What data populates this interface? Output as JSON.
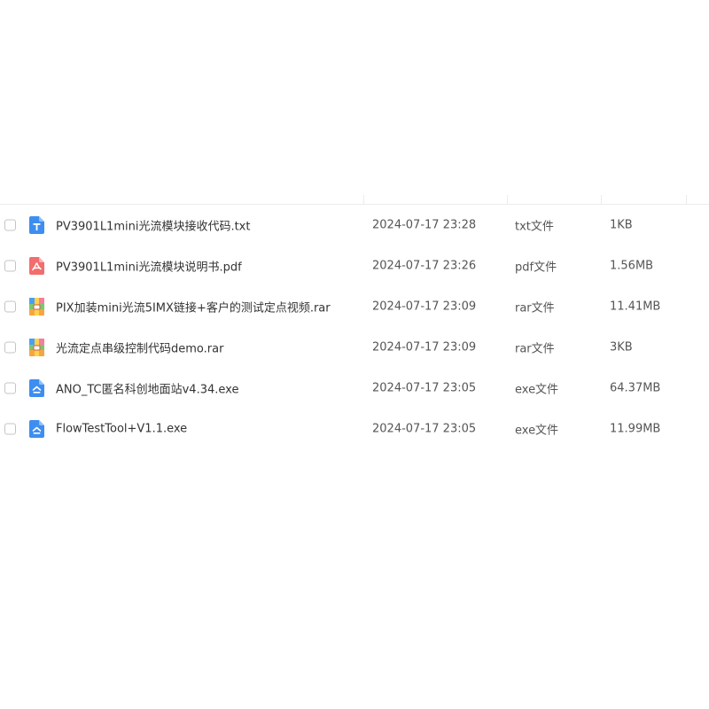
{
  "file_list": {
    "rows": [
      {
        "name": "PV3901L1mini光流模块接收代码.txt",
        "date": "2024-07-17 23:28",
        "type": "txt文件",
        "size": "1KB",
        "icon": "txt-file-icon"
      },
      {
        "name": "PV3901L1mini光流模块说明书.pdf",
        "date": "2024-07-17 23:26",
        "type": "pdf文件",
        "size": "1.56MB",
        "icon": "pdf-file-icon"
      },
      {
        "name": "PIX加装mini光流5IMX链接+客户的测试定点视频.rar",
        "date": "2024-07-17 23:09",
        "type": "rar文件",
        "size": "11.41MB",
        "icon": "rar-file-icon"
      },
      {
        "name": "光流定点串级控制代码demo.rar",
        "date": "2024-07-17 23:09",
        "type": "rar文件",
        "size": "3KB",
        "icon": "rar-file-icon"
      },
      {
        "name": "ANO_TC匿名科创地面站v4.34.exe",
        "date": "2024-07-17 23:05",
        "type": "exe文件",
        "size": "64.37MB",
        "icon": "exe-file-icon"
      },
      {
        "name": "FlowTestTool+V1.1.exe",
        "date": "2024-07-17 23:05",
        "type": "exe文件",
        "size": "11.99MB",
        "icon": "exe-file-icon"
      }
    ]
  },
  "colors": {
    "txt_icon": "#3d8ef0",
    "pdf_icon": "#f26d6d",
    "rar_icon_green": "#7bc86c",
    "rar_icon_orange": "#f7a541",
    "rar_icon_blue": "#4a9ff5",
    "exe_icon": "#3d8ef0",
    "checkbox_border": "#c4c4c4"
  }
}
